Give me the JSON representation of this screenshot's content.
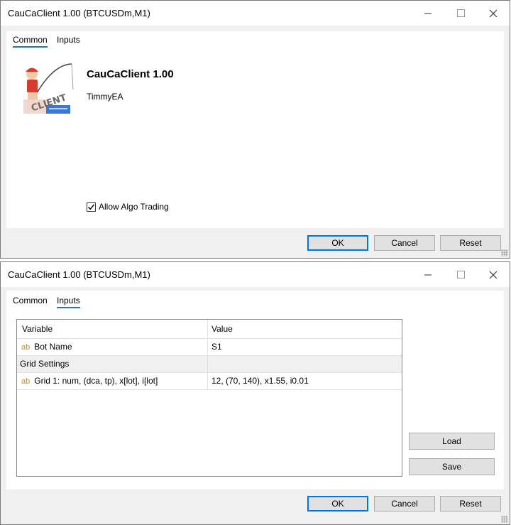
{
  "window1": {
    "title": "CauCaClient 1.00 (BTCUSDm,M1)",
    "tabs": [
      {
        "label": "Common",
        "active": true
      },
      {
        "label": "Inputs",
        "active": false
      }
    ],
    "ea_name": "CauCaClient 1.00",
    "ea_author": "TimmyEA",
    "logo_text": "CLIENT",
    "allow_algo_trading": {
      "label": "Allow Algo Trading",
      "checked": true
    },
    "buttons": {
      "ok": "OK",
      "cancel": "Cancel",
      "reset": "Reset"
    }
  },
  "window2": {
    "title": "CauCaClient 1.00 (BTCUSDm,M1)",
    "tabs": [
      {
        "label": "Common",
        "active": false
      },
      {
        "label": "Inputs",
        "active": true
      }
    ],
    "grid": {
      "headers": [
        "Variable",
        "Value"
      ],
      "rows": [
        {
          "type": "input",
          "icon": "ab",
          "variable": "Bot Name",
          "value": "S1"
        },
        {
          "type": "group",
          "variable": "Grid Settings",
          "value": ""
        },
        {
          "type": "input",
          "icon": "ab",
          "variable": "Grid 1: num, (dca, tp), x[lot], i[lot]",
          "value": "12, (70, 140), x1.55, i0.01"
        }
      ]
    },
    "side_buttons": {
      "load": "Load",
      "save": "Save"
    },
    "buttons": {
      "ok": "OK",
      "cancel": "Cancel",
      "reset": "Reset"
    }
  },
  "colors": {
    "accent": "#0078d7",
    "tab_underline": "#1f73d1",
    "window_bg": "#f0f0f0"
  }
}
